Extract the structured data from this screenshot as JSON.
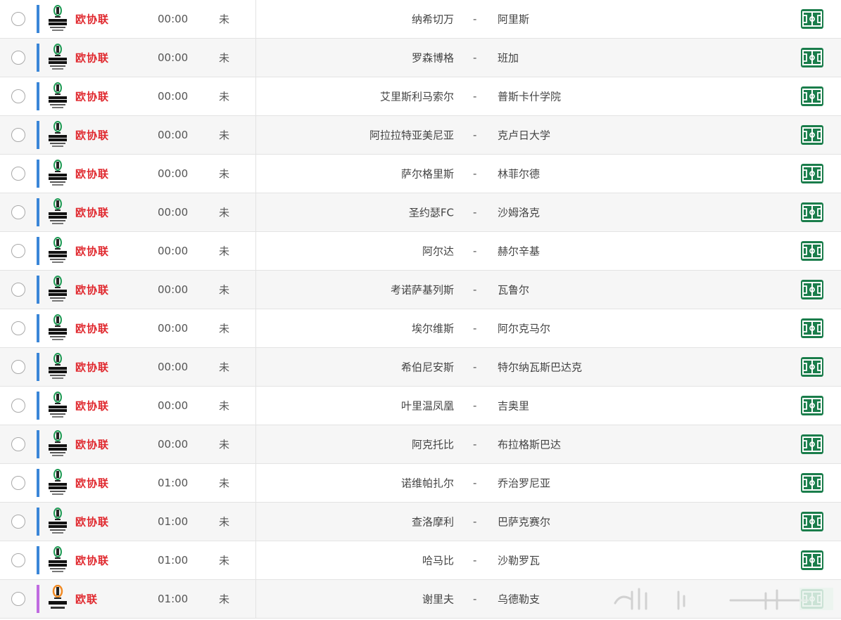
{
  "colors": {
    "league_red": "#e0282e",
    "bar_conference": "#3a86d8",
    "bar_europa": "#c06be0",
    "field_green": "#1a7d4b"
  },
  "icons": {
    "conference_logo": "uefa-europa-conference-league-logo",
    "europa_logo": "uefa-europa-league-logo",
    "field": "football-field-icon",
    "radio": "radio-button"
  },
  "matches": [
    {
      "league": "欧协联",
      "time": "00:00",
      "status": "未",
      "home": "纳希切万",
      "sep": "-",
      "away": "阿里斯",
      "type": "conference"
    },
    {
      "league": "欧协联",
      "time": "00:00",
      "status": "未",
      "home": "罗森博格",
      "sep": "-",
      "away": "班加",
      "type": "conference"
    },
    {
      "league": "欧协联",
      "time": "00:00",
      "status": "未",
      "home": "艾里斯利马索尔",
      "sep": "-",
      "away": "普斯卡什学院",
      "type": "conference"
    },
    {
      "league": "欧协联",
      "time": "00:00",
      "status": "未",
      "home": "阿拉拉特亚美尼亚",
      "sep": "-",
      "away": "克卢日大学",
      "type": "conference"
    },
    {
      "league": "欧协联",
      "time": "00:00",
      "status": "未",
      "home": "萨尔格里斯",
      "sep": "-",
      "away": "林菲尔德",
      "type": "conference"
    },
    {
      "league": "欧协联",
      "time": "00:00",
      "status": "未",
      "home": "圣约瑟FC",
      "sep": "-",
      "away": "沙姆洛克",
      "type": "conference"
    },
    {
      "league": "欧协联",
      "time": "00:00",
      "status": "未",
      "home": "阿尔达",
      "sep": "-",
      "away": "赫尔辛基",
      "type": "conference"
    },
    {
      "league": "欧协联",
      "time": "00:00",
      "status": "未",
      "home": "考诺萨基列斯",
      "sep": "-",
      "away": "瓦鲁尔",
      "type": "conference"
    },
    {
      "league": "欧协联",
      "time": "00:00",
      "status": "未",
      "home": "埃尔维斯",
      "sep": "-",
      "away": "阿尔克马尔",
      "type": "conference"
    },
    {
      "league": "欧协联",
      "time": "00:00",
      "status": "未",
      "home": "希伯尼安斯",
      "sep": "-",
      "away": "特尔纳瓦斯巴达克",
      "type": "conference"
    },
    {
      "league": "欧协联",
      "time": "00:00",
      "status": "未",
      "home": "叶里温凤凰",
      "sep": "-",
      "away": "吉奥里",
      "type": "conference"
    },
    {
      "league": "欧协联",
      "time": "00:00",
      "status": "未",
      "home": "阿克托比",
      "sep": "-",
      "away": "布拉格斯巴达",
      "type": "conference"
    },
    {
      "league": "欧协联",
      "time": "01:00",
      "status": "未",
      "home": "诺维帕扎尔",
      "sep": "-",
      "away": "乔治罗尼亚",
      "type": "conference"
    },
    {
      "league": "欧协联",
      "time": "01:00",
      "status": "未",
      "home": "查洛摩利",
      "sep": "-",
      "away": "巴萨克赛尔",
      "type": "conference"
    },
    {
      "league": "欧协联",
      "time": "01:00",
      "status": "未",
      "home": "哈马比",
      "sep": "-",
      "away": "沙勒罗瓦",
      "type": "conference"
    },
    {
      "league": "欧联",
      "time": "01:00",
      "status": "未",
      "home": "谢里夫",
      "sep": "-",
      "away": "乌德勒支",
      "type": "europa"
    }
  ]
}
